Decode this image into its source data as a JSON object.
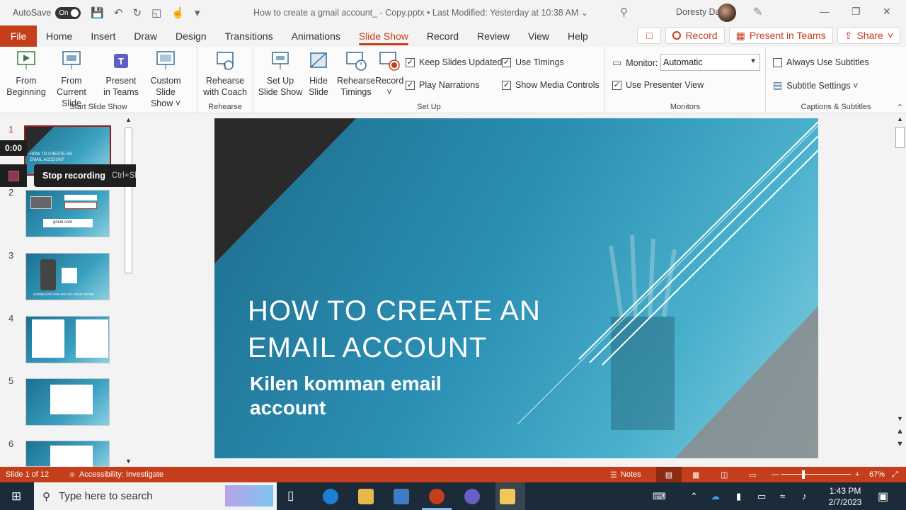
{
  "titlebar": {
    "autosave_label": "AutoSave",
    "autosave_state": "On",
    "document_title": "How to create a gmail account_ - Copy.pptx • Last Modified: Yesterday at 10:38 AM ⌄",
    "user_name": "Doresty Daniel"
  },
  "menubar": {
    "file": "File",
    "tabs": [
      "Home",
      "Insert",
      "Draw",
      "Design",
      "Transitions",
      "Animations",
      "Slide Show",
      "Record",
      "Review",
      "View",
      "Help"
    ],
    "active_tab": "Slide Show",
    "record_button": "Record",
    "present_in_teams_button": "Present in Teams",
    "share_button": "Share"
  },
  "ribbon": {
    "start_slide_show": {
      "label": "Start Slide Show",
      "from_beginning": [
        "From",
        "Beginning"
      ],
      "from_current": [
        "From",
        "Current Slide"
      ],
      "present_in_teams": [
        "Present",
        "in Teams"
      ],
      "custom_slide_show": [
        "Custom Slide",
        "Show ˅"
      ]
    },
    "rehearse": {
      "label": "Rehearse",
      "rehearse_with_coach": [
        "Rehearse",
        "with Coach"
      ]
    },
    "set_up": {
      "label": "Set Up",
      "set_up_slide_show": [
        "Set Up",
        "Slide Show"
      ],
      "hide_slide": [
        "Hide",
        "Slide"
      ],
      "rehearse_timings": [
        "Rehearse",
        "Timings"
      ],
      "record": [
        "Record",
        "˅"
      ],
      "keep_slides_updated": "Keep Slides Updated",
      "use_timings": "Use Timings",
      "play_narrations": "Play Narrations",
      "show_media_controls": "Show Media Controls"
    },
    "monitors": {
      "label": "Monitors",
      "monitor_label": "Monitor:",
      "monitor_value": "Automatic",
      "use_presenter_view": "Use Presenter View"
    },
    "captions": {
      "label": "Captions & Subtitles",
      "always_use_subtitles": "Always Use Subtitles",
      "subtitle_settings": "Subtitle Settings ˅"
    }
  },
  "slides_panel": {
    "numbers": [
      "1",
      "2",
      "3",
      "4",
      "5",
      "6"
    ],
    "selected": "1"
  },
  "recording": {
    "timer": "0:00",
    "tooltip_label": "Stop recording",
    "tooltip_shortcut": "Ctrl+Shift+L"
  },
  "slide": {
    "title_line1": "HOW TO CREATE AN",
    "title_line2": "EMAIL ACCOUNT",
    "subtitle_line1": "Kilen komman email",
    "subtitle_line2": "account"
  },
  "thumbs": {
    "t1_line1": "HOW TO CREATE AN",
    "t1_line2": "EMAIL ACCOUNT",
    "t2_text": "gmail.com",
    "t3_text": "DOWNLOAD THE APP ON YOUR PHONE"
  },
  "statusbar": {
    "slide_counter": "Slide 1 of 12",
    "accessibility": "Accessibility: Investigate",
    "notes": "Notes",
    "zoom": "67%"
  },
  "taskbar": {
    "search_placeholder": "Type here to search",
    "time": "1:43 PM",
    "date": "2/7/2023"
  },
  "colors": {
    "accent": "#c43e1c",
    "slide_primary": "#2a8fb3"
  }
}
